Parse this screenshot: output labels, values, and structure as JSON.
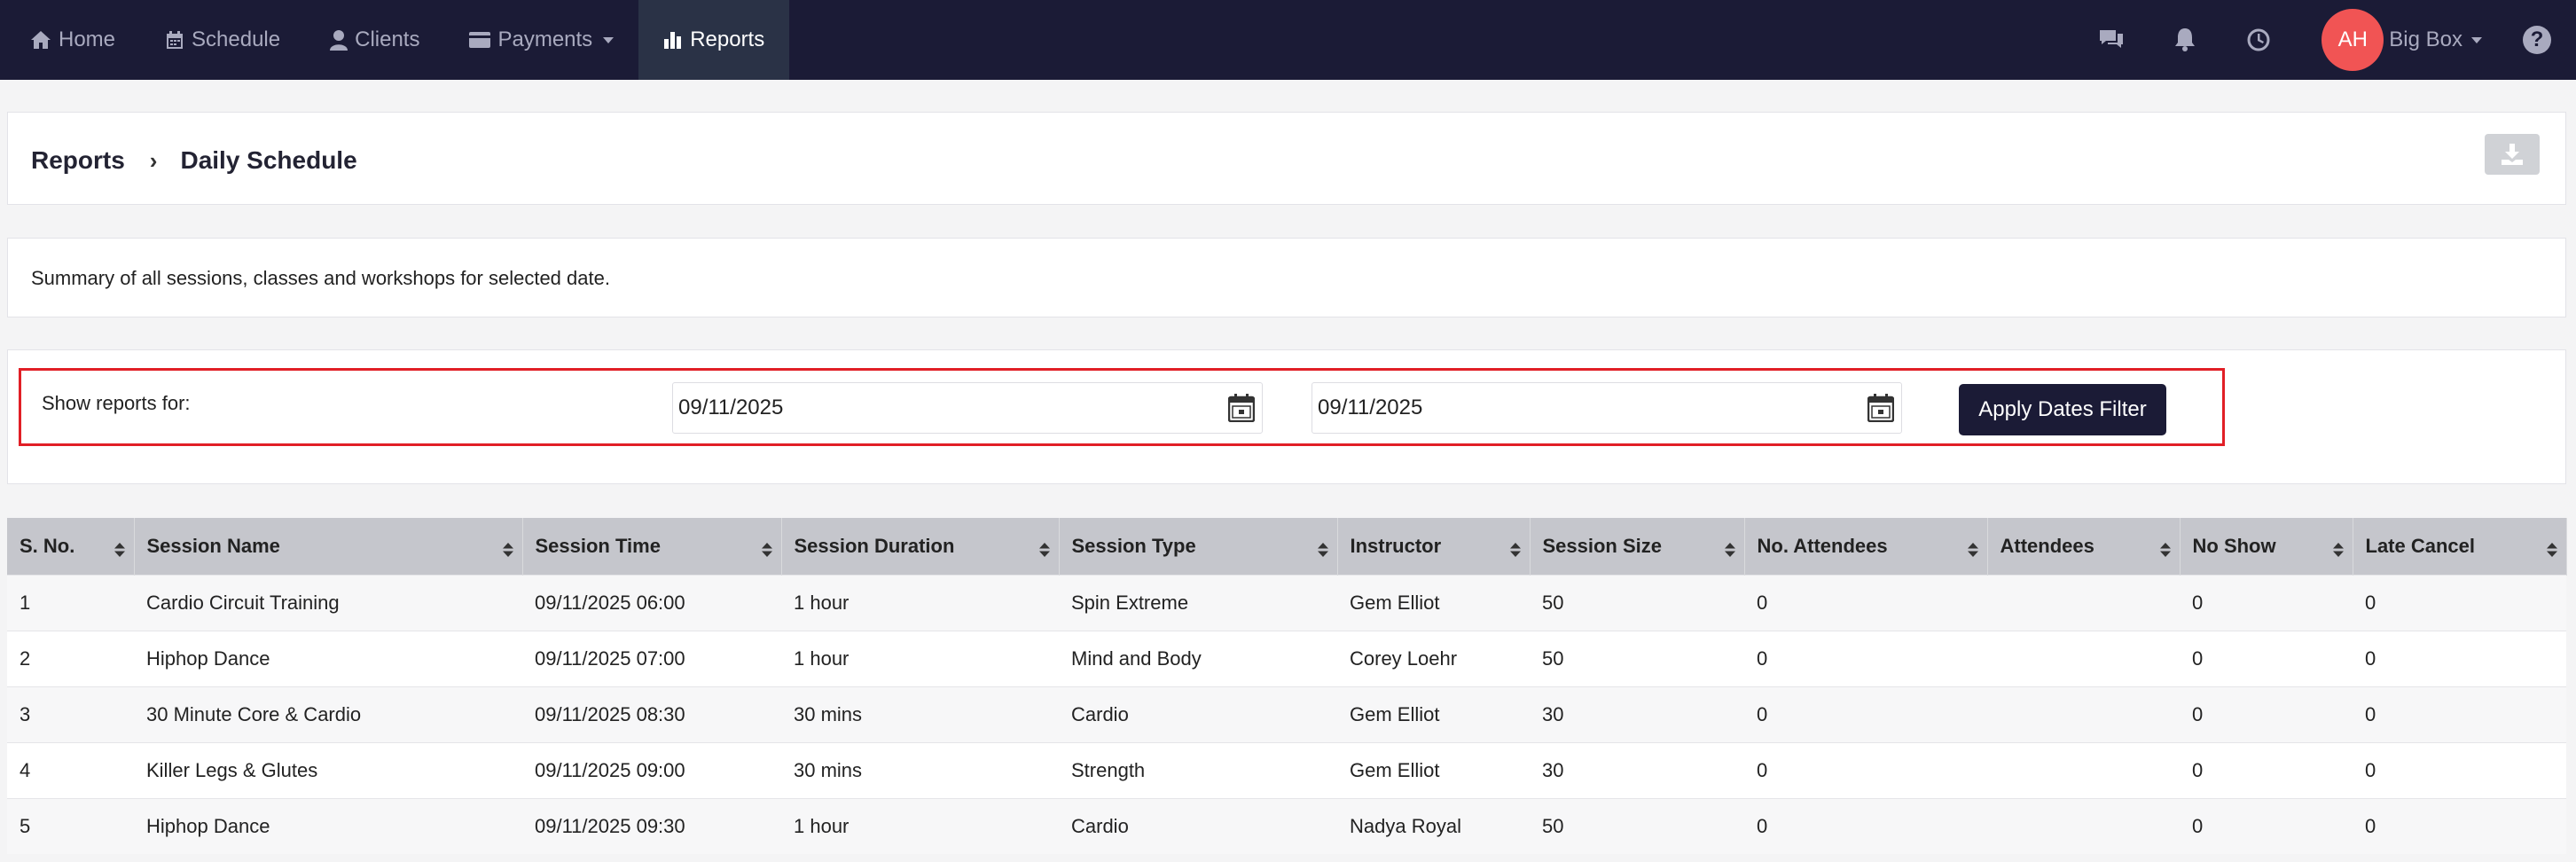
{
  "nav": {
    "items": [
      {
        "label": "Home",
        "icon": "home-icon"
      },
      {
        "label": "Schedule",
        "icon": "calendar-icon"
      },
      {
        "label": "Clients",
        "icon": "user-icon"
      },
      {
        "label": "Payments",
        "icon": "credit-card-icon"
      },
      {
        "label": "Reports",
        "icon": "bar-chart-icon"
      }
    ],
    "active": "Reports",
    "avatar_initials": "AH",
    "avatar_color": "#f15454",
    "user_name": "Big Box",
    "help_symbol": "?"
  },
  "breadcrumb": {
    "root": "Reports",
    "separator": "›",
    "current": "Daily Schedule"
  },
  "description": "Summary of all sessions, classes and workshops for selected date.",
  "filter": {
    "label": "Show reports for:",
    "start_date": "09/11/2025",
    "end_date": "09/11/2025",
    "apply_label": "Apply Dates Filter"
  },
  "table": {
    "headers": [
      "S. No.",
      "Session Name",
      "Session Time",
      "Session Duration",
      "Session Type",
      "Instructor",
      "Session Size",
      "No. Attendees",
      "Attendees",
      "No Show",
      "Late Cancel"
    ],
    "rows": [
      [
        "1",
        "Cardio Circuit Training",
        "09/11/2025 06:00",
        "1 hour",
        "Spin Extreme",
        "Gem Elliot",
        "50",
        "0",
        "",
        "0",
        "0"
      ],
      [
        "2",
        "Hiphop Dance",
        "09/11/2025 07:00",
        "1 hour",
        "Mind and Body",
        "Corey Loehr",
        "50",
        "0",
        "",
        "0",
        "0"
      ],
      [
        "3",
        "30 Minute Core & Cardio",
        "09/11/2025 08:30",
        "30 mins",
        "Cardio",
        "Gem Elliot",
        "30",
        "0",
        "",
        "0",
        "0"
      ],
      [
        "4",
        "Killer Legs & Glutes",
        "09/11/2025 09:00",
        "30 mins",
        "Strength",
        "Gem Elliot",
        "30",
        "0",
        "",
        "0",
        "0"
      ],
      [
        "5",
        "Hiphop Dance",
        "09/11/2025 09:30",
        "1 hour",
        "Cardio",
        "Nadya Royal",
        "50",
        "0",
        "",
        "0",
        "0"
      ]
    ]
  },
  "colors": {
    "nav_bg": "#1b1b36",
    "active_tab": "#2a3246",
    "filter_highlight": "#e11f26",
    "button_bg": "#1b1b36",
    "table_header": "#c5c6cc"
  }
}
